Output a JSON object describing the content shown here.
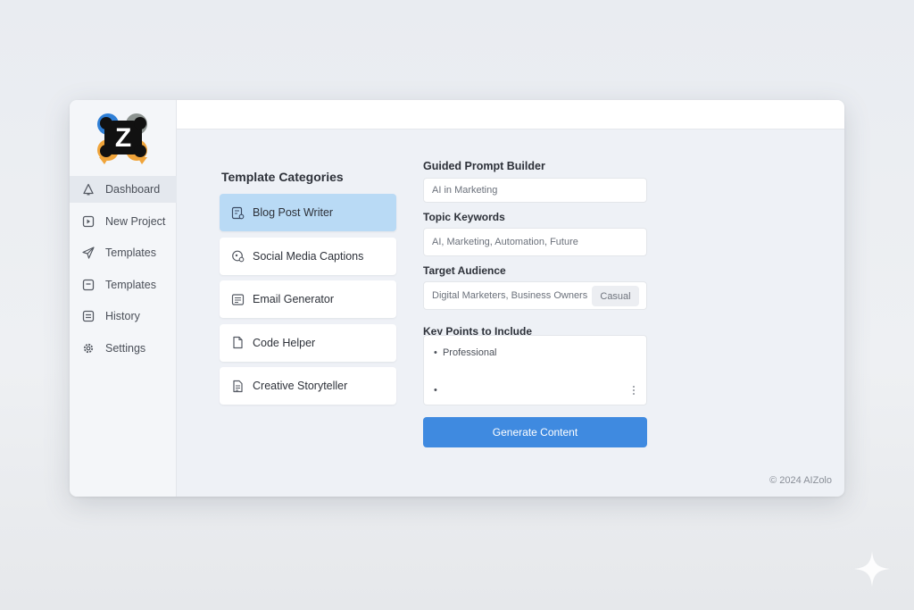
{
  "sidebar": {
    "logo_letter": "Z",
    "items": [
      {
        "label": "Dashboard",
        "icon": "bell-icon"
      },
      {
        "label": "New Project",
        "icon": "new-project-icon"
      },
      {
        "label": "Templates",
        "icon": "paper-plane-icon"
      },
      {
        "label": "Templates",
        "icon": "inbox-icon"
      },
      {
        "label": "History",
        "icon": "list-icon"
      },
      {
        "label": "Settings",
        "icon": "gear-icon"
      }
    ]
  },
  "categories": {
    "title": "Template Categories",
    "items": [
      {
        "label": "Blog Post Writer",
        "icon": "document-gear-icon"
      },
      {
        "label": "Social Media Captions",
        "icon": "share-icon"
      },
      {
        "label": "Email Generator",
        "icon": "envelope-icon"
      },
      {
        "label": "Code Helper",
        "icon": "file-icon"
      },
      {
        "label": "Creative Storyteller",
        "icon": "story-document-icon"
      }
    ]
  },
  "form": {
    "title": "Guided Prompt Builder",
    "topic_placeholder": "AI in Marketing",
    "keywords_label": "Topic Keywords",
    "keywords_value": "AI, Marketing, Automation, Future",
    "audience_label": "Target Audience",
    "audience_value": "Digital Marketers, Business Owners",
    "tone_chip": "Casual",
    "keypoints_label": "Key Points to Include",
    "keypoints": [
      "Professional",
      ""
    ],
    "button_label": "Generate Content"
  },
  "footer": {
    "copyright": "© 2024 AIZolo"
  },
  "colors": {
    "accent": "#3f8ae0",
    "active_card": "#b9daf5",
    "window_bg": "#eef1f6"
  }
}
